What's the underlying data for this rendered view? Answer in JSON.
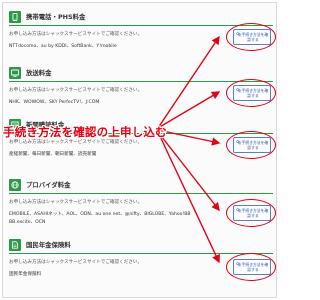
{
  "annotation": {
    "text": "手続き方法を確認の上申し込む",
    "color": "#e60012"
  },
  "colors": {
    "section_accent": "#2e9a49",
    "button_border": "#5a7fc6",
    "button_text": "#2754a8",
    "highlight": "#e60012"
  },
  "sections": [
    {
      "title": "携帯電話・PHS料金",
      "icon": "mobile-phone-icon",
      "description": "お申し込み方法はシャックスサービスサイトでご確認ください。",
      "providers": "NTTdocomo、au by KDDI、SoftBank、Y!mobile",
      "button": "お手続き方法を確認する"
    },
    {
      "title": "放送料金",
      "icon": "tv-icon",
      "description": "お申し込み方法はシャックスサービスサイトでご確認ください。",
      "providers": "NHK、WOWOW、SKY PerfecTV!、J:COM",
      "button": "お手続き方法を確認する"
    },
    {
      "title": "新聞購読料金",
      "icon": "newspaper-icon",
      "description": "お申し込み方法はシャックスサービスサイトでご確認ください。",
      "providers": "産経新聞、毎日新聞、朝日新聞、読売新聞",
      "button": "お手続き方法を確認する"
    },
    {
      "title": "プロバイダ料金",
      "icon": "globe-icon",
      "description": "お申し込み方法はシャックスサービスサイトでご確認ください。",
      "providers": "EMOBILE、ASAHIネット、AOL、ODN、au one net、@nifty、BIGLOBE、Yahoo!BB",
      "providers_line2": "BB.excite、OCN",
      "button": "お手続き方法を確認する"
    },
    {
      "title": "国民年金保険料",
      "icon": "document-icon",
      "description": "お申し込み方法はシャックスサービスサイトでご確認ください。",
      "providers": "国民年金保険料",
      "button": "お手続き方法を確認する"
    }
  ]
}
